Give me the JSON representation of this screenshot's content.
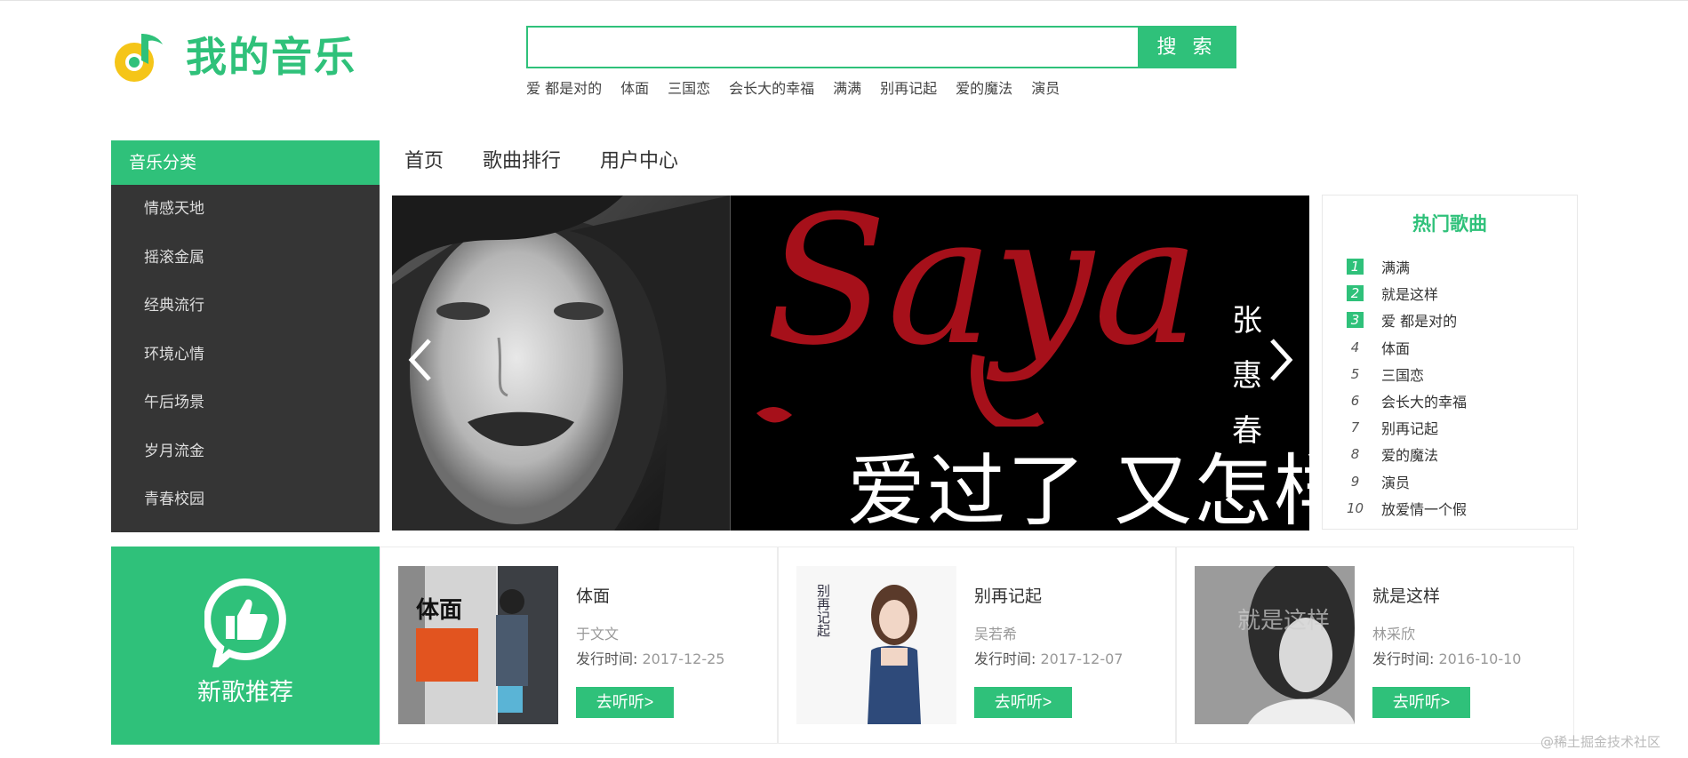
{
  "app": {
    "logo_text": "我的音乐"
  },
  "search": {
    "value": "",
    "placeholder": "",
    "button_label": "搜 索",
    "hot_words": [
      "爱 都是对的",
      "体面",
      "三国恋",
      "会长大的幸福",
      "满满",
      "别再记起",
      "爱的魔法",
      "演员"
    ]
  },
  "sidebar": {
    "title": "音乐分类",
    "items": [
      "情感天地",
      "摇滚金属",
      "经典流行",
      "环境心情",
      "午后场景",
      "岁月流金",
      "青春校园"
    ]
  },
  "nav": {
    "items": [
      "首页",
      "歌曲排行",
      "用户中心"
    ]
  },
  "banner": {
    "script_word": "Saya",
    "artist": "张惠春",
    "title": "爱过了 又怎样"
  },
  "hot_songs": {
    "title": "热门歌曲",
    "items": [
      {
        "rank": "1",
        "name": "满满"
      },
      {
        "rank": "2",
        "name": "就是这样"
      },
      {
        "rank": "3",
        "name": "爱 都是对的"
      },
      {
        "rank": "4",
        "name": "体面"
      },
      {
        "rank": "5",
        "name": "三国恋"
      },
      {
        "rank": "6",
        "name": "会长大的幸福"
      },
      {
        "rank": "7",
        "name": "别再记起"
      },
      {
        "rank": "8",
        "name": "爱的魔法"
      },
      {
        "rank": "9",
        "name": "演员"
      },
      {
        "rank": "10",
        "name": "放爱情一个假"
      }
    ]
  },
  "new_songs": {
    "label": "新歌推荐",
    "date_label": "发行时间:",
    "button_label": "去听听>",
    "cards": [
      {
        "title": "体面",
        "artist": "于文文",
        "date": "2017-12-25",
        "cover_text": "体面"
      },
      {
        "title": "别再记起",
        "artist": "吴若希",
        "date": "2017-12-07",
        "cover_text": "别再记起"
      },
      {
        "title": "就是这样",
        "artist": "林采欣",
        "date": "2016-10-10",
        "cover_text": "就是这样"
      }
    ]
  },
  "watermark": "@稀土掘金技术社区",
  "colors": {
    "accent": "#2fc17a",
    "sidebar_bg": "#353535",
    "logo_yellow": "#f5c518"
  }
}
